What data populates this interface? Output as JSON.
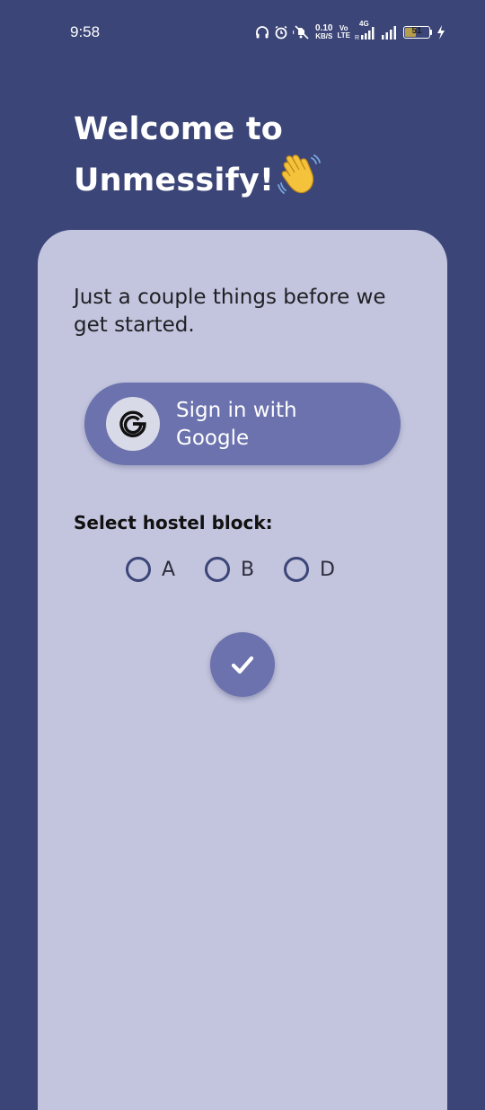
{
  "status_bar": {
    "time": "9:58",
    "network_speed_value": "0.10",
    "network_speed_unit": "KB/S",
    "volte_top": "Vo",
    "volte_bottom": "LTE",
    "network_type": "4G",
    "battery_level": "51",
    "battery_fraction": 0.51,
    "icons": [
      "headphones-icon",
      "alarm-icon",
      "mute-icon",
      "wifi-calling-icon",
      "signal-icon",
      "signal-icon",
      "battery-icon",
      "charging-icon"
    ]
  },
  "header": {
    "title_line1": "Welcome to",
    "title_line2": "Unmessify!"
  },
  "card": {
    "intro_text": "Just a couple things before we get started.",
    "google_button": {
      "label_line1": "Sign in with",
      "label_line2": "Google",
      "icon": "google-icon"
    },
    "hostel_block": {
      "label": "Select hostel block:",
      "options": [
        {
          "label": "A",
          "selected": false
        },
        {
          "label": "B",
          "selected": false
        },
        {
          "label": "D",
          "selected": false
        }
      ]
    },
    "confirm_icon": "check-icon"
  },
  "colors": {
    "background": "#3b4577",
    "card": "#c3c5de",
    "accent": "#6b72ad",
    "text_dark": "#1f2024",
    "white": "#ffffff"
  }
}
